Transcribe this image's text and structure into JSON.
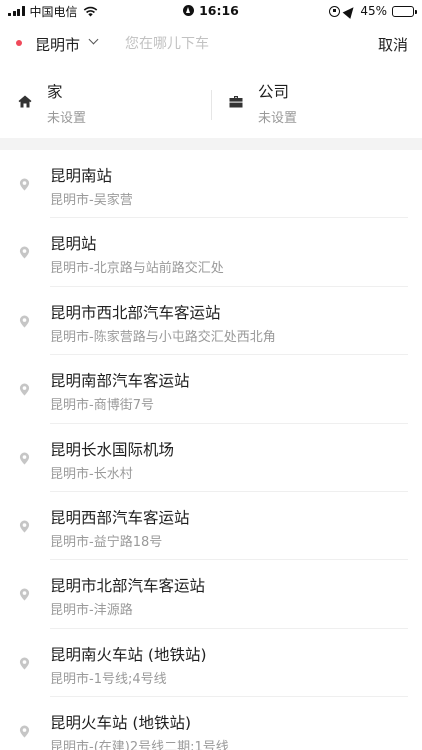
{
  "status_bar": {
    "carrier": "中国电信",
    "time": "16:16",
    "battery": "45%",
    "battery_level": 0.45
  },
  "search": {
    "city": "昆明市",
    "placeholder": "您在哪儿下车",
    "cancel_label": "取消"
  },
  "quick": {
    "home": {
      "title": "家",
      "subtitle": "未设置",
      "icon": "home-icon"
    },
    "company": {
      "title": "公司",
      "subtitle": "未设置",
      "icon": "briefcase-icon"
    }
  },
  "results": [
    {
      "name": "昆明南站",
      "address": "昆明市-吴家营"
    },
    {
      "name": "昆明站",
      "address": "昆明市-北京路与站前路交汇处"
    },
    {
      "name": "昆明市西北部汽车客运站",
      "address": "昆明市-陈家营路与小屯路交汇处西北角"
    },
    {
      "name": "昆明南部汽车客运站",
      "address": "昆明市-商博街7号"
    },
    {
      "name": "昆明长水国际机场",
      "address": "昆明市-长水村"
    },
    {
      "name": "昆明西部汽车客运站",
      "address": "昆明市-益宁路18号"
    },
    {
      "name": "昆明市北部汽车客运站",
      "address": "昆明市-沣源路"
    },
    {
      "name": "昆明南火车站 (地铁站)",
      "address": "昆明市-1号线;4号线"
    },
    {
      "name": "昆明火车站 (地铁站)",
      "address": "昆明市-(在建)2号线二期;1号线"
    }
  ],
  "colors": {
    "accent": "#f0495a",
    "muted_text": "#999999",
    "icon_gray": "#c8c8c8"
  }
}
